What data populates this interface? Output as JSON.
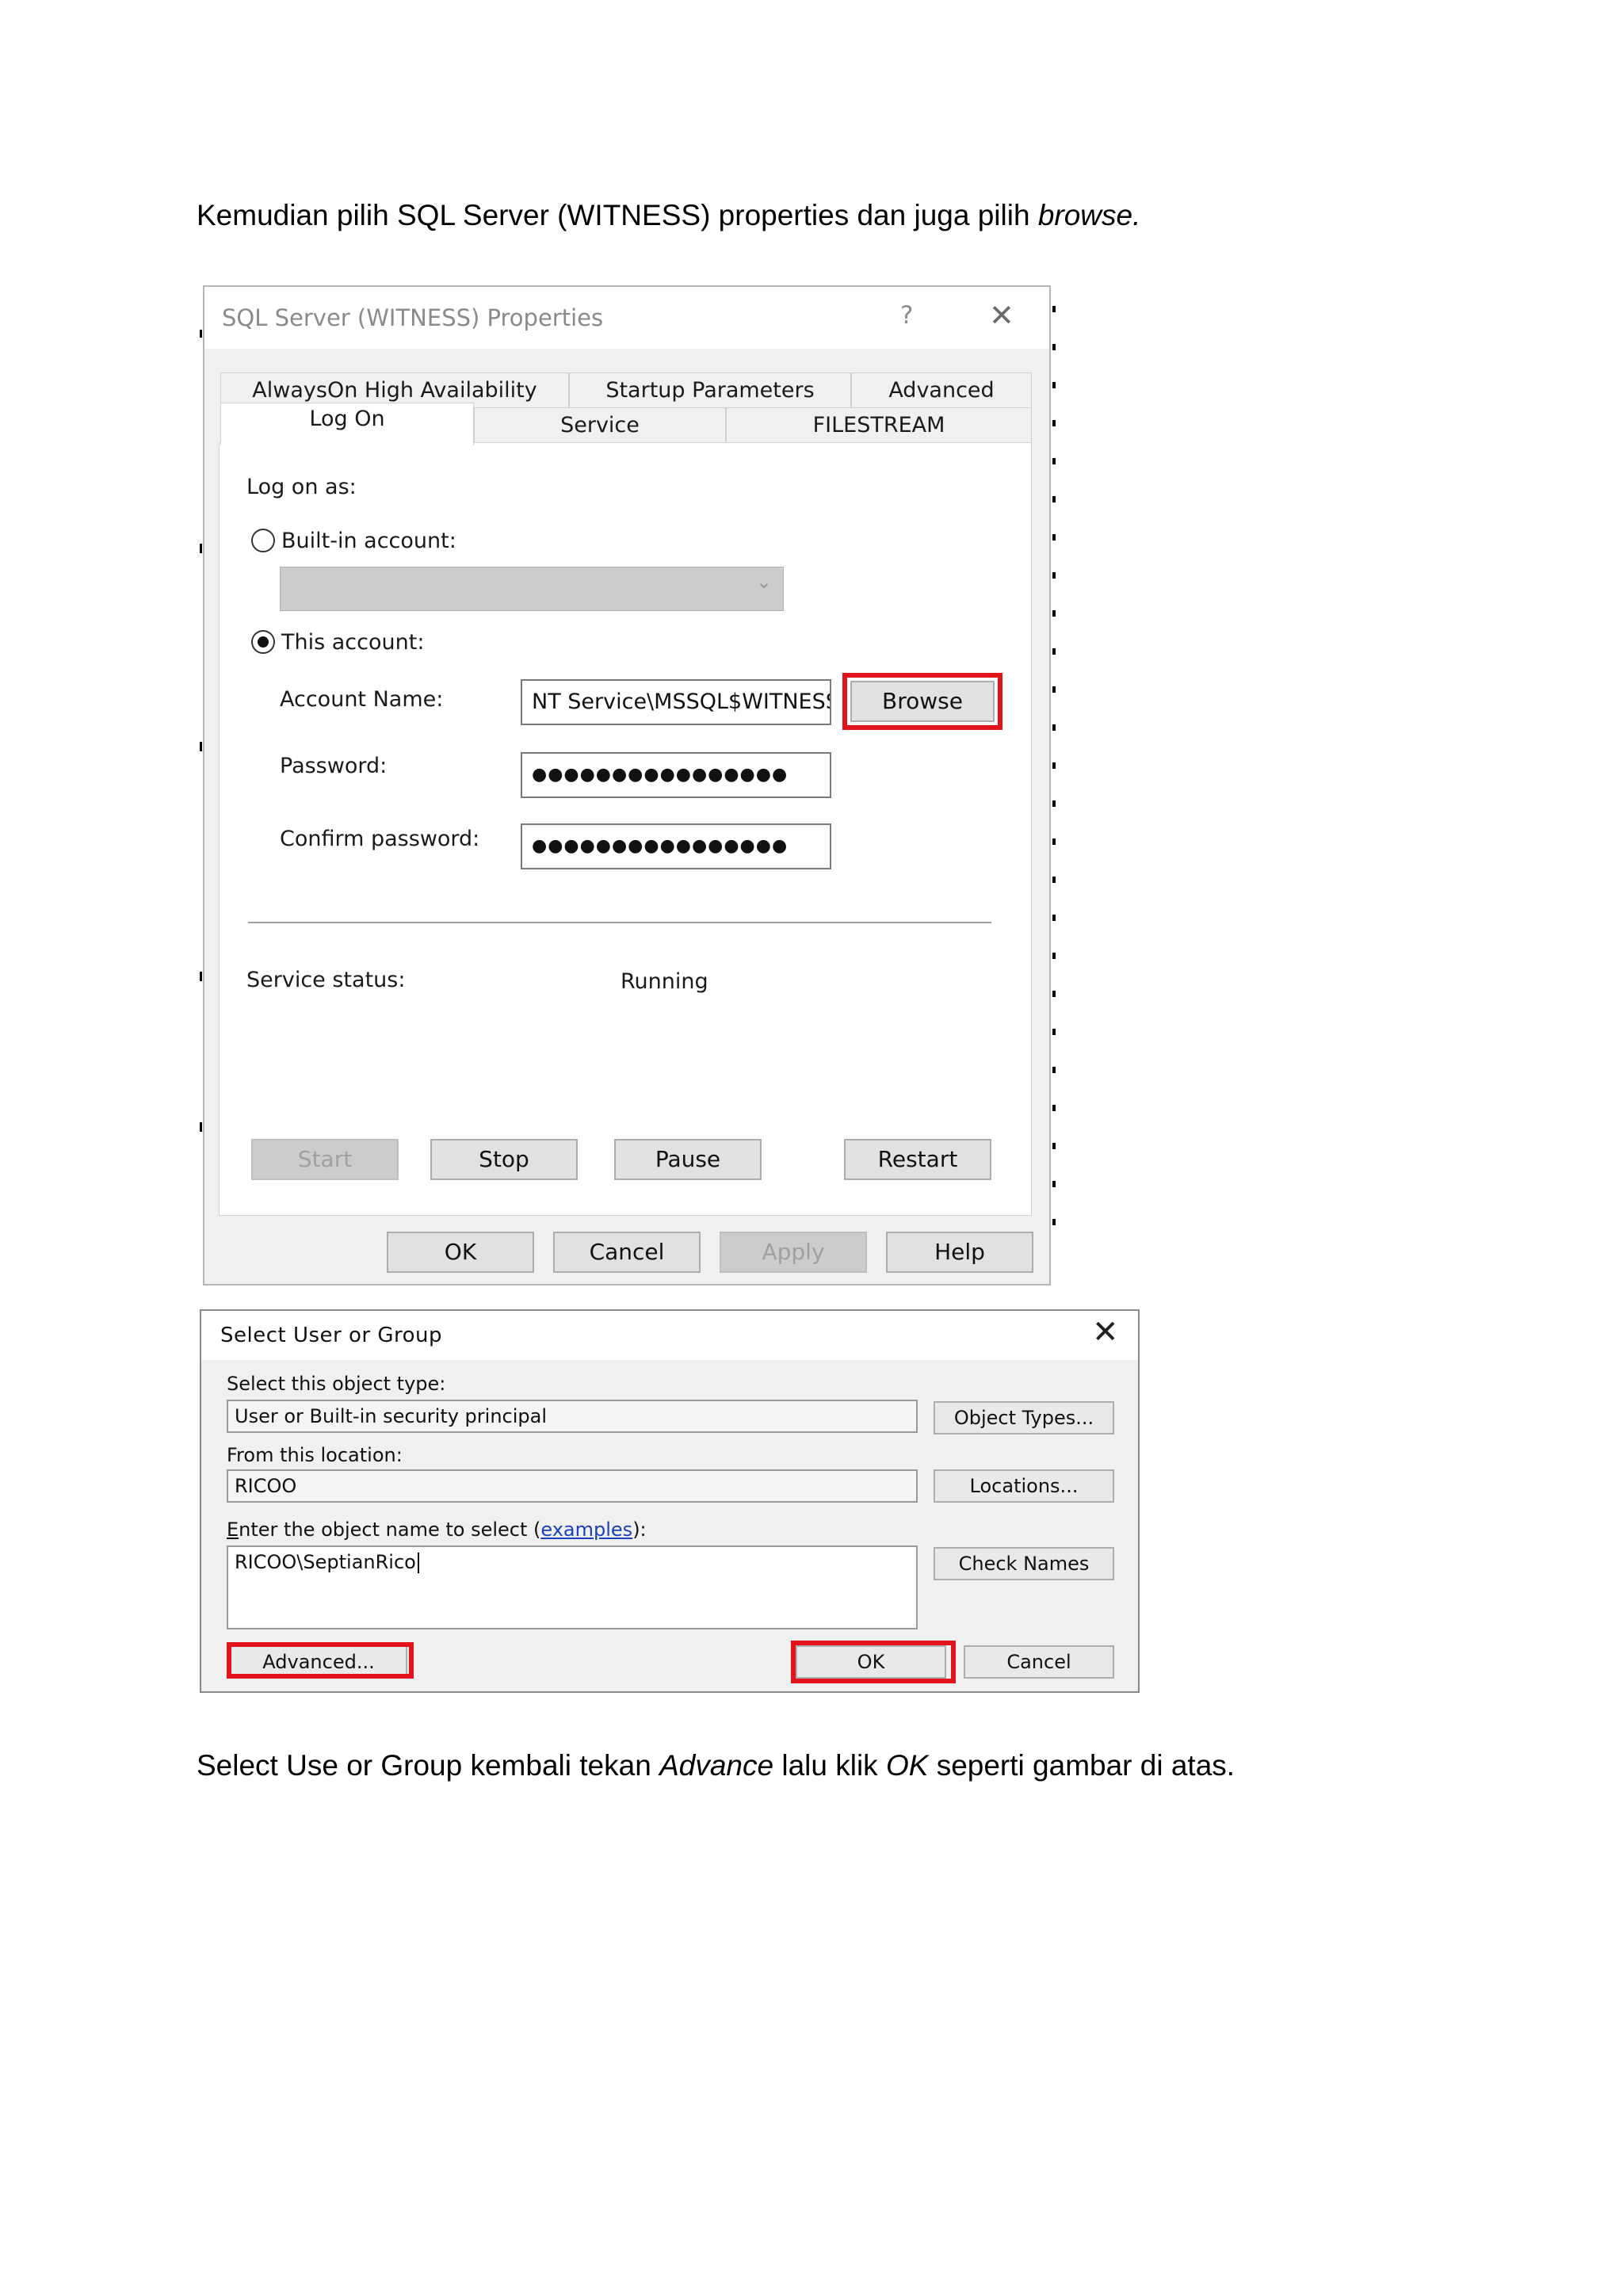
{
  "paragraphs": {
    "intro_plain": "Kemudian pilih SQL Server (WITNESS) properties dan juga pilih ",
    "intro_italic": "browse.",
    "outro_part1": "Select Use or Group kembali tekan ",
    "outro_italic1": "Advance",
    "outro_part2": " lalu klik ",
    "outro_italic2": "OK",
    "outro_part3": " seperti gambar di atas."
  },
  "sql_dialog": {
    "title": "SQL Server (WITNESS) Properties",
    "help_glyph": "?",
    "close_glyph": "✕",
    "tabs_row1": [
      "AlwaysOn High Availability",
      "Startup Parameters",
      "Advanced"
    ],
    "tabs_row2": [
      "Log On",
      "Service",
      "FILESTREAM"
    ],
    "active_tab": "Log On",
    "log_on_as_label": "Log on as:",
    "builtin_account_label": "Built-in account:",
    "builtin_account_value": "",
    "this_account_label": "This account:",
    "selected_option": "This account",
    "account_name_label": "Account Name:",
    "account_name_value": "NT Service\\MSSQL$WITNESS",
    "password_label": "Password:",
    "password_value": "●●●●●●●●●●●●●●●●",
    "confirm_password_label": "Confirm password:",
    "confirm_password_value": "●●●●●●●●●●●●●●●●",
    "browse_button": "Browse",
    "service_status_label": "Service status:",
    "service_status_value": "Running",
    "service_buttons": {
      "start": "Start",
      "stop": "Stop",
      "pause": "Pause",
      "restart": "Restart"
    },
    "footer_buttons": {
      "ok": "OK",
      "cancel": "Cancel",
      "apply": "Apply",
      "help": "Help"
    }
  },
  "select_dialog": {
    "title": "Select User or Group",
    "close_glyph": "✕",
    "object_type_label": "Select this object type:",
    "object_type_value": "User or Built-in security principal",
    "object_types_button": "Object Types...",
    "location_label": "From this location:",
    "location_value": "RICOO",
    "locations_button": "Locations...",
    "enter_name_label_accel": "E",
    "enter_name_label_rest": "nter the object name to select (",
    "examples_link": "examples",
    "enter_name_label_end": "):",
    "object_name_value": "RICOO\\SeptianRico",
    "check_names_button": "Check Names",
    "advanced_button": "Advanced...",
    "ok_button": "OK",
    "cancel_button": "Cancel"
  },
  "colors": {
    "highlight_box": "#e0141a",
    "dialog_bg": "#f0f0f0",
    "link": "#1a3fbf"
  }
}
